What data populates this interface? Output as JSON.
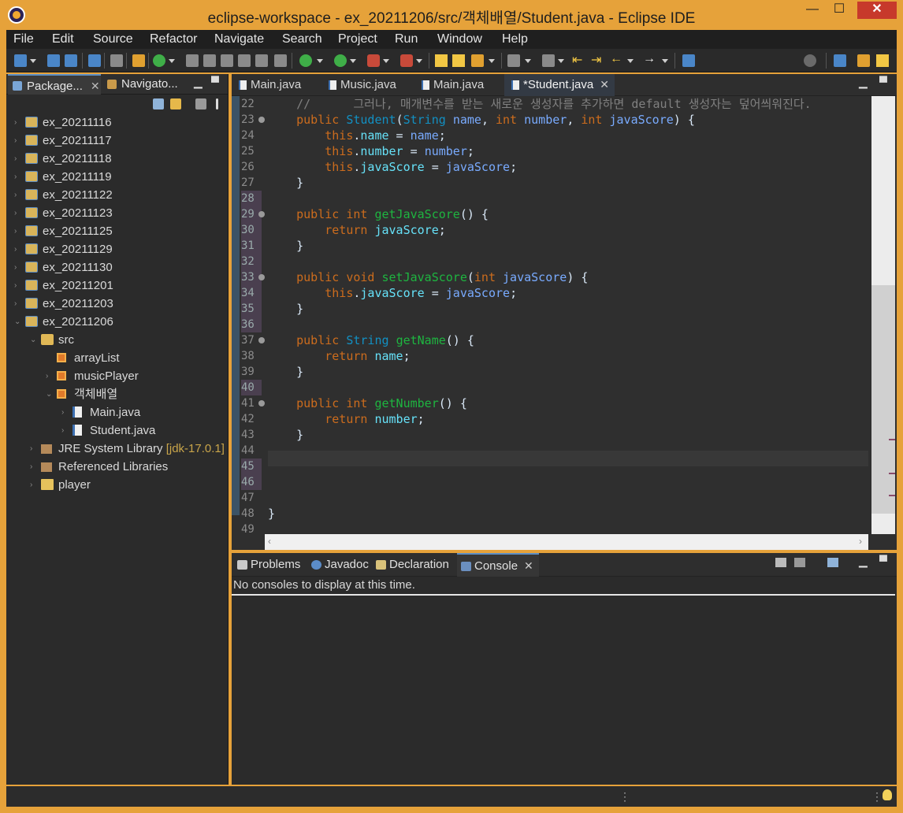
{
  "window": {
    "title": "eclipse-workspace - ex_20211206/src/객체배열/Student.java - Eclipse IDE",
    "minimize": "—",
    "maximize": "☐",
    "close": "✕"
  },
  "menu": [
    "File",
    "Edit",
    "Source",
    "Refactor",
    "Navigate",
    "Search",
    "Project",
    "Run",
    "Window",
    "Help"
  ],
  "left_panel": {
    "tabs": [
      {
        "label": "Package...",
        "close": "✕"
      },
      {
        "label": "Navigato..."
      }
    ],
    "tree": [
      {
        "label": "ex_20211116",
        "icon": "project-icon",
        "twisty": "›"
      },
      {
        "label": "ex_20211117",
        "icon": "project-icon",
        "twisty": "›"
      },
      {
        "label": "ex_20211118",
        "icon": "project-icon",
        "twisty": "›"
      },
      {
        "label": "ex_20211119",
        "icon": "project-icon",
        "twisty": "›"
      },
      {
        "label": "ex_20211122",
        "icon": "project-icon",
        "twisty": "›"
      },
      {
        "label": "ex_20211123",
        "icon": "project-icon",
        "twisty": "›"
      },
      {
        "label": "ex_20211125",
        "icon": "project-icon",
        "twisty": "›"
      },
      {
        "label": "ex_20211129",
        "icon": "project-icon",
        "twisty": "›"
      },
      {
        "label": "ex_20211130",
        "icon": "project-icon",
        "twisty": "›"
      },
      {
        "label": "ex_20211201",
        "icon": "project-icon",
        "twisty": "›"
      },
      {
        "label": "ex_20211203",
        "icon": "project-icon",
        "twisty": "›"
      },
      {
        "label": "ex_20211206",
        "icon": "project-icon",
        "twisty": "⌄"
      },
      {
        "label": "src",
        "icon": "source-folder-icon",
        "twisty": "⌄"
      },
      {
        "label": "arrayList",
        "icon": "package-icon",
        "twisty": ""
      },
      {
        "label": "musicPlayer",
        "icon": "package-icon",
        "twisty": "›"
      },
      {
        "label": "객체배열",
        "icon": "package-icon",
        "twisty": "⌄"
      },
      {
        "label": "Main.java",
        "icon": "java-file-icon",
        "twisty": "›"
      },
      {
        "label": "Student.java",
        "icon": "java-file-icon",
        "twisty": "›"
      },
      {
        "label": "JRE System Library",
        "decoration": "[jdk-17.0.1]",
        "icon": "library-icon",
        "twisty": "›"
      },
      {
        "label": "Referenced Libraries",
        "icon": "library-icon",
        "twisty": "›"
      },
      {
        "label": "player",
        "icon": "folder-icon",
        "twisty": "›"
      }
    ]
  },
  "editor": {
    "tabs": [
      {
        "label": "Main.java",
        "active": false
      },
      {
        "label": "Music.java",
        "active": false
      },
      {
        "label": "Main.java",
        "active": false
      },
      {
        "label": "*Student.java",
        "active": true,
        "close": "✕"
      }
    ],
    "lines": [
      {
        "n": "22",
        "text": "    //      그러나, 매개변수를 받는 새로운 생성자를 추가하면 default 생성자는 덮어씌워진다.",
        "kind": "comment"
      },
      {
        "n": "23",
        "fold": true
      },
      {
        "n": "24"
      },
      {
        "n": "25"
      },
      {
        "n": "26"
      },
      {
        "n": "27"
      },
      {
        "n": "28",
        "mark": true
      },
      {
        "n": "29",
        "fold": true,
        "mark": true
      },
      {
        "n": "30",
        "mark": true
      },
      {
        "n": "31",
        "mark": true
      },
      {
        "n": "32",
        "mark": true
      },
      {
        "n": "33",
        "fold": true,
        "mark": true
      },
      {
        "n": "34",
        "mark": true
      },
      {
        "n": "35",
        "mark": true
      },
      {
        "n": "36",
        "mark": true
      },
      {
        "n": "37",
        "fold": true
      },
      {
        "n": "38"
      },
      {
        "n": "39"
      },
      {
        "n": "40",
        "mark": true
      },
      {
        "n": "41",
        "fold": true
      },
      {
        "n": "42"
      },
      {
        "n": "43"
      },
      {
        "n": "44"
      },
      {
        "n": "45",
        "mark": true
      },
      {
        "n": "46",
        "mark": true
      },
      {
        "n": "47"
      },
      {
        "n": "48"
      },
      {
        "n": "49"
      }
    ],
    "code": {
      "l23": {
        "a": "public ",
        "b": "Student",
        "c": "(",
        "d": "String ",
        "e": "name",
        "f": ", ",
        "g": "int ",
        "h": "number",
        "i": ", ",
        "j": "int ",
        "k": "javaScore",
        "l": ") {"
      },
      "l24": {
        "a": "this",
        "b": ".",
        "c": "name",
        "d": " = ",
        "e": "name",
        "f": ";"
      },
      "l25": {
        "a": "this",
        "b": ".",
        "c": "number",
        "d": " = ",
        "e": "number",
        "f": ";"
      },
      "l26": {
        "a": "this",
        "b": ".",
        "c": "javaScore",
        "d": " = ",
        "e": "javaScore",
        "f": ";"
      },
      "l27": "}",
      "l29": {
        "a": "public ",
        "b": "int ",
        "c": "getJavaScore",
        "d": "() {"
      },
      "l30": {
        "a": "return ",
        "b": "javaScore",
        "c": ";"
      },
      "l31": "}",
      "l33": {
        "a": "public ",
        "b": "void ",
        "c": "setJavaScore",
        "d": "(",
        "e": "int ",
        "f": "javaScore",
        "g": ") {"
      },
      "l34": {
        "a": "this",
        "b": ".",
        "c": "javaScore",
        "d": " = ",
        "e": "javaScore",
        "f": ";"
      },
      "l35": "}",
      "l37": {
        "a": "public ",
        "b": "String ",
        "c": "getName",
        "d": "() {"
      },
      "l38": {
        "a": "return ",
        "b": "name",
        "c": ";"
      },
      "l39": "}",
      "l41": {
        "a": "public ",
        "b": "int ",
        "c": "getNumber",
        "d": "() {"
      },
      "l42": {
        "a": "return ",
        "b": "number",
        "c": ";"
      },
      "l43": "}",
      "l48": "}"
    }
  },
  "bottom_panel": {
    "tabs": [
      {
        "label": "Problems"
      },
      {
        "label": "Javadoc"
      },
      {
        "label": "Declaration"
      },
      {
        "label": "Console",
        "active": true,
        "close": "✕"
      }
    ],
    "message": "No consoles to display at this time."
  },
  "colors": {
    "title_bar": "#e6a23a",
    "close_button": "#c7392b",
    "keyword": "#cc6c1d",
    "type": "#1290c3",
    "method": "#1eb540",
    "field": "#66e1f8",
    "parameter": "#79abff"
  }
}
